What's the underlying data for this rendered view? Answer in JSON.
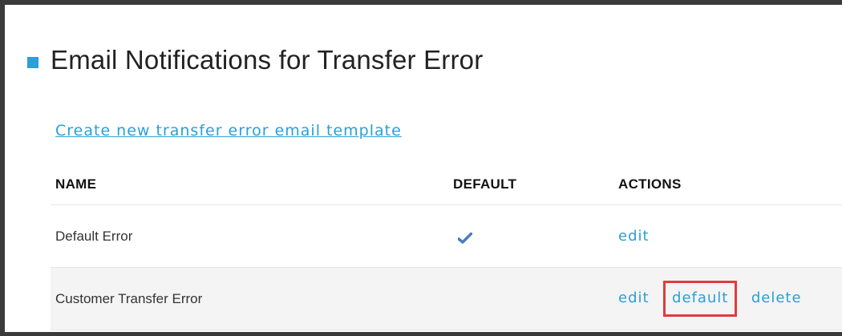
{
  "section": {
    "title": "Email Notifications for Transfer Error",
    "create_link": "Create new transfer error email template"
  },
  "table": {
    "headers": {
      "name": "NAME",
      "default": "DEFAULT",
      "actions": "ACTIONS"
    },
    "rows": [
      {
        "name": "Default Error",
        "is_default": true,
        "actions": {
          "edit": "edit"
        }
      },
      {
        "name": "Customer Transfer Error",
        "is_default": false,
        "actions": {
          "edit": "edit",
          "default": "default",
          "delete": "delete"
        }
      }
    ]
  },
  "icons": {
    "heading_marker": "square-bullet-icon",
    "default_marker": "checkmark-icon"
  },
  "colors": {
    "accent": "#2a9fd8",
    "highlight": "#e03c3c",
    "check": "#4a7fb8"
  }
}
